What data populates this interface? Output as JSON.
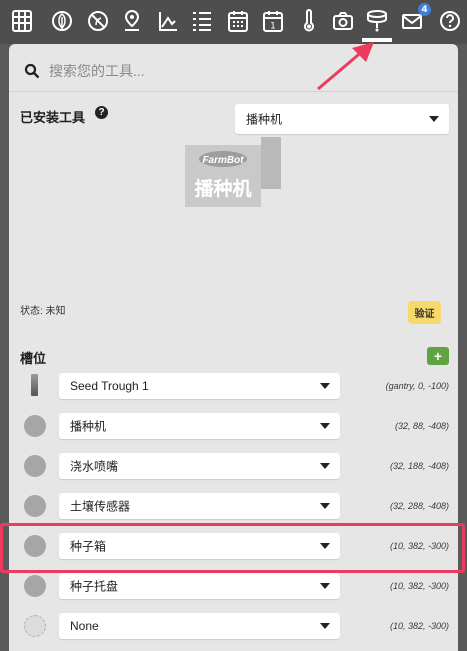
{
  "nav": {
    "items": [
      "grid-icon",
      "leaf-icon",
      "no-weeds-icon",
      "map-pin-icon",
      "curve-chart-icon",
      "list-icon",
      "calendar-icon",
      "calendar-day-icon",
      "thermometer-icon",
      "camera-icon",
      "tool-mount-icon",
      "mail-icon",
      "help-icon"
    ],
    "calendar_day_number": "1",
    "mail_badge": "4"
  },
  "search": {
    "placeholder": "搜索您的工具..."
  },
  "installed": {
    "title": "已安装工具",
    "help_glyph": "?",
    "selected_tool": "播种机",
    "logo_text": "FarmBot",
    "image_caption": "播种机",
    "status": "状态: 未知",
    "verify_label": "验证"
  },
  "slots": {
    "title": "槽位",
    "add_label": "+",
    "rows": [
      {
        "tool": "Seed Trough 1",
        "coords": "(gantry, 0, -100)",
        "icon": "seed-trough-icon"
      },
      {
        "tool": "播种机",
        "coords": "(32, 88, -408)",
        "icon": "slot-circle-icon"
      },
      {
        "tool": "浇水喷嘴",
        "coords": "(32, 188, -408)",
        "icon": "slot-circle-icon"
      },
      {
        "tool": "土壤传感器",
        "coords": "(32, 288, -408)",
        "icon": "slot-circle-icon"
      },
      {
        "tool": "种子箱",
        "coords": "(10, 382, -300)",
        "icon": "slot-circle-icon"
      },
      {
        "tool": "种子托盘",
        "coords": "(10, 382, -300)",
        "icon": "slot-circle-icon"
      },
      {
        "tool": "None",
        "coords": "(10, 382, -300)",
        "icon": "empty-slot-icon"
      }
    ]
  },
  "colors": {
    "highlight": "#ec3b5e",
    "verify": "#f6d86b",
    "add": "#60a343",
    "badge": "#3f7fd9"
  }
}
